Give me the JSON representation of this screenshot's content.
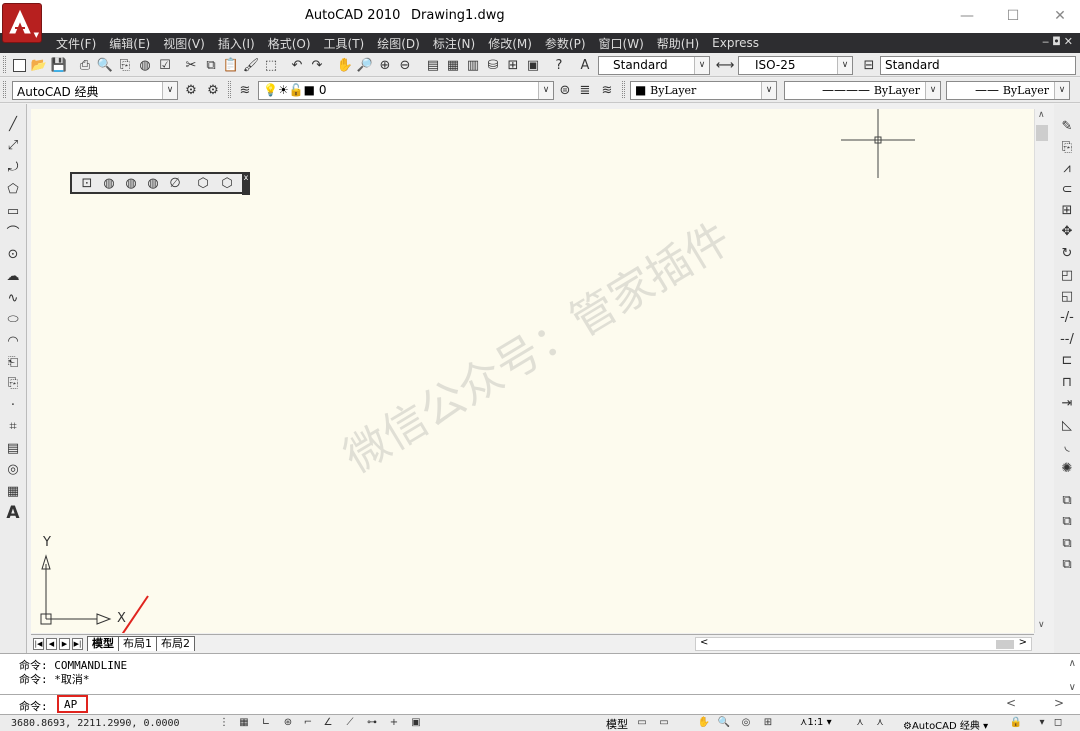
{
  "window": {
    "app_title": "AutoCAD 2010",
    "file_name": "Drawing1.dwg",
    "minimize": "—",
    "maximize": "☐",
    "close": "✕"
  },
  "menu": [
    {
      "label": "文件(F)"
    },
    {
      "label": "编辑(E)"
    },
    {
      "label": "视图(V)"
    },
    {
      "label": "插入(I)"
    },
    {
      "label": "格式(O)"
    },
    {
      "label": "工具(T)"
    },
    {
      "label": "绘图(D)"
    },
    {
      "label": "标注(N)"
    },
    {
      "label": "修改(M)"
    },
    {
      "label": "参数(P)"
    },
    {
      "label": "窗口(W)"
    },
    {
      "label": "帮助(H)"
    },
    {
      "label": "Express"
    }
  ],
  "toolbar": {
    "text_style": "Standard",
    "dim_style": "ISO-25",
    "table_style": "Standard",
    "workspace": "AutoCAD 经典",
    "layer": "0",
    "color": "ByLayer",
    "linetype": "ByLayer",
    "lineweight": "ByLayer"
  },
  "layout_tabs": {
    "model": "模型",
    "layout1": "布局1",
    "layout2": "布局2"
  },
  "ucs": {
    "x_label": "X",
    "y_label": "Y"
  },
  "command_history": [
    "命令: COMMANDLINE",
    "命令: *取消*"
  ],
  "command_prompt": {
    "label": "命令:",
    "input_value": "AP"
  },
  "status": {
    "coordinates": "3680.8693,  2211.2990,  0.0000",
    "model_label": "模型",
    "annotation_scale": "1:1",
    "workspace_switch": "AutoCAD 经典"
  },
  "watermark": "微信公众号：管家插件",
  "colors": {
    "canvas_bg": "#fdfbee",
    "menubar_bg": "#2d2d30",
    "highlight_red": "#e0241e",
    "logo_red": "#b7201f"
  }
}
